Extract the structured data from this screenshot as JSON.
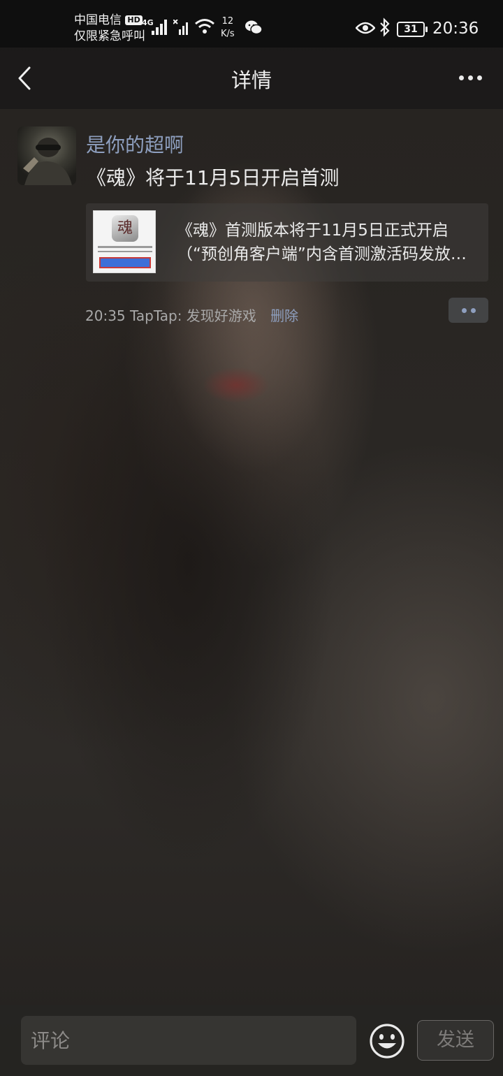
{
  "status_bar": {
    "carrier_line1": "中国电信",
    "hd_badge": "HD",
    "carrier_line2": "仅限紧急呼叫",
    "network_type": "4G",
    "speed_value": "12",
    "speed_unit": "K/s",
    "battery": "31",
    "time": "20:36",
    "icons": [
      "signal-icon",
      "no-signal-icon",
      "wifi-icon",
      "wechat-icon",
      "eye-icon",
      "bluetooth-icon",
      "battery-icon"
    ]
  },
  "nav": {
    "title": "详情",
    "back_icon": "chevron-left-icon",
    "more_icon": "more-dots-icon"
  },
  "post": {
    "author": "是你的超啊",
    "text": "《魂》将于11月5日开启首测",
    "link": {
      "line1": "《魂》首测版本将于11月5日正式开启",
      "line2": "（“预创角客户端”内含首测激活码发放…",
      "thumb_logo_glyph": "魂"
    },
    "time": "20:35",
    "source": "TapTap: 发现好游戏",
    "delete_label": "删除"
  },
  "composer": {
    "placeholder": "评论",
    "send_label": "发送",
    "emoji_icon": "emoji-icon"
  },
  "colors": {
    "link_blue": "#8e9fbf",
    "status_bg": "#0f0f0f"
  }
}
